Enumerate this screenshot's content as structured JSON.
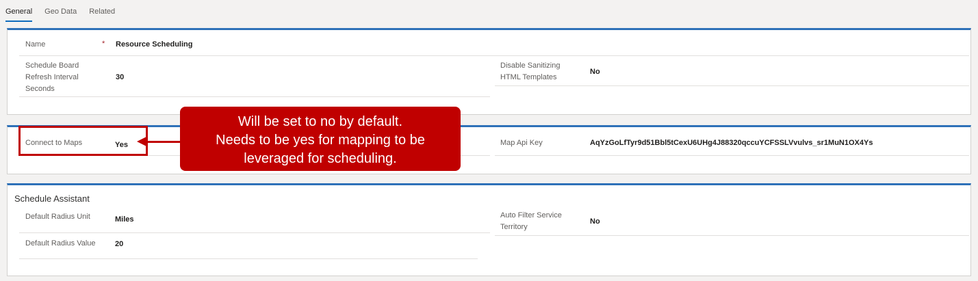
{
  "tabs": [
    {
      "label": "General",
      "active": true
    },
    {
      "label": "Geo Data",
      "active": false
    },
    {
      "label": "Related",
      "active": false
    }
  ],
  "general": {
    "name": {
      "label": "Name",
      "required": "*",
      "value": "Resource Scheduling"
    },
    "refresh_interval": {
      "label_lines": [
        "Schedule Board",
        "Refresh Interval",
        "Seconds"
      ],
      "value": "30"
    },
    "disable_sanitizing": {
      "label_lines": [
        "Disable Sanitizing",
        "HTML Templates"
      ],
      "value": "No"
    }
  },
  "maps": {
    "connect_to_maps": {
      "label": "Connect to Maps",
      "value": "Yes"
    },
    "map_api_key": {
      "label": "Map Api Key",
      "value": "AqYzGoLfTyr9d51Bbl5tCexU6UHg4J88320qccuYCFSSLVvulvs_sr1MuN1OX4Ys"
    }
  },
  "schedule_assistant": {
    "title": "Schedule Assistant",
    "radius_unit": {
      "label": "Default Radius Unit",
      "value": "Miles"
    },
    "radius_value": {
      "label": "Default Radius Value",
      "value": "20"
    },
    "auto_filter": {
      "label_lines": [
        "Auto Filter Service",
        "Territory"
      ],
      "value": "No"
    }
  },
  "callout": {
    "lines": [
      "Will be set to no by default.",
      "Needs to be yes for mapping to be",
      "leveraged for scheduling."
    ],
    "color": "#c00000"
  },
  "colors": {
    "accent": "#2e71b8",
    "tab_underline": "#0f6cbd",
    "required": "#a4262c"
  }
}
